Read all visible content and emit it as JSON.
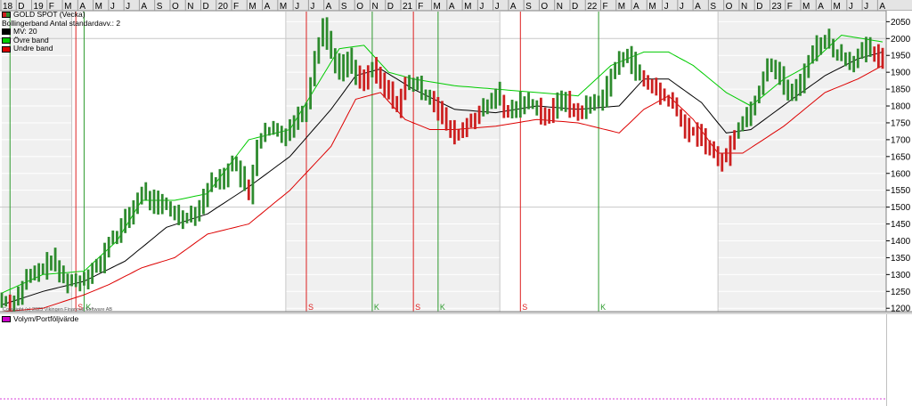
{
  "chart_data": {
    "type": "candlestick-bar",
    "title": "GOLD SPOT (Vecka)",
    "legend": [
      {
        "name": "GOLD SPOT (Vecka)",
        "color": "#2e8b2e",
        "color2": "#cc2020"
      },
      {
        "name": "Bollingerband  Antal standardavv.: 2",
        "color": null
      },
      {
        "name": "MV: 20",
        "color": "#000000"
      },
      {
        "name": "Övre band",
        "color": "#00cc00"
      },
      {
        "name": "Undre band",
        "color": "#dd0000"
      }
    ],
    "volume_legend": {
      "name": "Volym/Portföljvärde",
      "color": "#cc00cc"
    },
    "copyright": "Copyright (c) 2023 Vikingen Financial Software AB",
    "x_axis_months": [
      "18",
      "D",
      "19",
      "F",
      "M",
      "A",
      "M",
      "J",
      "J",
      "A",
      "S",
      "O",
      "N",
      "D",
      "20",
      "F",
      "M",
      "A",
      "M",
      "J",
      "J",
      "A",
      "S",
      "O",
      "N",
      "D",
      "21",
      "F",
      "M",
      "A",
      "M",
      "J",
      "J",
      "A",
      "S",
      "O",
      "N",
      "D",
      "22",
      "F",
      "M",
      "A",
      "M",
      "J",
      "J",
      "A",
      "S",
      "O",
      "N",
      "D",
      "23",
      "F",
      "M",
      "A",
      "M",
      "J",
      "J",
      "A"
    ],
    "y_ticks": [
      1200,
      1250,
      1300,
      1350,
      1400,
      1450,
      1500,
      1550,
      1600,
      1650,
      1700,
      1750,
      1800,
      1850,
      1900,
      1950,
      2000,
      2050
    ],
    "ylim": [
      1190,
      2080
    ],
    "signals": [
      {
        "label": "",
        "type": "buy"
      },
      {
        "label": "S",
        "type": "sell"
      },
      {
        "label": "K",
        "type": "buy"
      },
      {
        "label": "S",
        "type": "sell"
      },
      {
        "label": "K",
        "type": "buy"
      },
      {
        "label": "S",
        "type": "sell"
      },
      {
        "label": "K",
        "type": "buy"
      },
      {
        "label": "S",
        "type": "sell"
      },
      {
        "label": "K",
        "type": "buy"
      }
    ],
    "series": [
      {
        "name": "GOLD SPOT (Vecka)",
        "type": "ohlc",
        "keypoints": [
          [
            0,
            1225
          ],
          [
            2,
            1215
          ],
          [
            4,
            1240
          ],
          [
            6,
            1290
          ],
          [
            8,
            1300
          ],
          [
            10,
            1320
          ],
          [
            12,
            1345
          ],
          [
            14,
            1300
          ],
          [
            16,
            1280
          ],
          [
            18,
            1280
          ],
          [
            20,
            1290
          ],
          [
            22,
            1320
          ],
          [
            24,
            1330
          ],
          [
            26,
            1400
          ],
          [
            28,
            1420
          ],
          [
            30,
            1460
          ],
          [
            32,
            1500
          ],
          [
            34,
            1545
          ],
          [
            36,
            1520
          ],
          [
            38,
            1510
          ],
          [
            40,
            1500
          ],
          [
            42,
            1480
          ],
          [
            44,
            1470
          ],
          [
            46,
            1480
          ],
          [
            48,
            1500
          ],
          [
            50,
            1560
          ],
          [
            52,
            1580
          ],
          [
            54,
            1590
          ],
          [
            56,
            1640
          ],
          [
            58,
            1590
          ],
          [
            60,
            1530
          ],
          [
            62,
            1690
          ],
          [
            64,
            1720
          ],
          [
            66,
            1730
          ],
          [
            68,
            1710
          ],
          [
            70,
            1740
          ],
          [
            72,
            1770
          ],
          [
            74,
            1800
          ],
          [
            76,
            1950
          ],
          [
            78,
            2040
          ],
          [
            80,
            1960
          ],
          [
            82,
            1900
          ],
          [
            84,
            1940
          ],
          [
            86,
            1890
          ],
          [
            88,
            1880
          ],
          [
            90,
            1910
          ],
          [
            92,
            1870
          ],
          [
            94,
            1840
          ],
          [
            96,
            1800
          ],
          [
            98,
            1860
          ],
          [
            100,
            1870
          ],
          [
            102,
            1840
          ],
          [
            104,
            1830
          ],
          [
            106,
            1790
          ],
          [
            108,
            1740
          ],
          [
            110,
            1710
          ],
          [
            112,
            1730
          ],
          [
            114,
            1760
          ],
          [
            116,
            1780
          ],
          [
            118,
            1800
          ],
          [
            120,
            1840
          ],
          [
            122,
            1780
          ],
          [
            124,
            1790
          ],
          [
            126,
            1810
          ],
          [
            128,
            1810
          ],
          [
            130,
            1800
          ],
          [
            132,
            1760
          ],
          [
            134,
            1790
          ],
          [
            136,
            1830
          ],
          [
            138,
            1790
          ],
          [
            140,
            1780
          ],
          [
            142,
            1800
          ],
          [
            144,
            1810
          ],
          [
            146,
            1830
          ],
          [
            148,
            1890
          ],
          [
            150,
            1930
          ],
          [
            152,
            1960
          ],
          [
            154,
            1900
          ],
          [
            156,
            1870
          ],
          [
            158,
            1860
          ],
          [
            160,
            1830
          ],
          [
            162,
            1820
          ],
          [
            164,
            1780
          ],
          [
            166,
            1730
          ],
          [
            168,
            1720
          ],
          [
            170,
            1710
          ],
          [
            172,
            1670
          ],
          [
            174,
            1640
          ],
          [
            176,
            1650
          ],
          [
            178,
            1720
          ],
          [
            180,
            1760
          ],
          [
            182,
            1790
          ],
          [
            184,
            1850
          ],
          [
            186,
            1930
          ],
          [
            188,
            1910
          ],
          [
            190,
            1860
          ],
          [
            192,
            1830
          ],
          [
            194,
            1870
          ],
          [
            196,
            1940
          ],
          [
            198,
            1980
          ],
          [
            200,
            2000
          ],
          [
            202,
            1960
          ],
          [
            204,
            1950
          ],
          [
            206,
            1930
          ],
          [
            208,
            1950
          ],
          [
            210,
            1970
          ],
          [
            212,
            1950
          ],
          [
            214,
            1930
          ]
        ]
      },
      {
        "name": "MV: 20",
        "type": "line",
        "keypoints": [
          [
            0,
            1210
          ],
          [
            10,
            1250
          ],
          [
            20,
            1280
          ],
          [
            30,
            1340
          ],
          [
            40,
            1440
          ],
          [
            50,
            1480
          ],
          [
            60,
            1560
          ],
          [
            70,
            1650
          ],
          [
            80,
            1790
          ],
          [
            86,
            1890
          ],
          [
            92,
            1910
          ],
          [
            100,
            1850
          ],
          [
            110,
            1790
          ],
          [
            120,
            1780
          ],
          [
            130,
            1800
          ],
          [
            140,
            1790
          ],
          [
            150,
            1800
          ],
          [
            156,
            1880
          ],
          [
            162,
            1880
          ],
          [
            170,
            1810
          ],
          [
            176,
            1720
          ],
          [
            182,
            1730
          ],
          [
            192,
            1820
          ],
          [
            200,
            1890
          ],
          [
            208,
            1940
          ],
          [
            214,
            1960
          ]
        ]
      },
      {
        "name": "Övre band",
        "type": "line",
        "keypoints": [
          [
            0,
            1245
          ],
          [
            10,
            1300
          ],
          [
            20,
            1310
          ],
          [
            28,
            1400
          ],
          [
            34,
            1520
          ],
          [
            42,
            1520
          ],
          [
            50,
            1540
          ],
          [
            60,
            1700
          ],
          [
            70,
            1730
          ],
          [
            76,
            1850
          ],
          [
            82,
            1970
          ],
          [
            88,
            1980
          ],
          [
            94,
            1900
          ],
          [
            100,
            1880
          ],
          [
            110,
            1860
          ],
          [
            120,
            1850
          ],
          [
            130,
            1840
          ],
          [
            140,
            1830
          ],
          [
            148,
            1920
          ],
          [
            156,
            1960
          ],
          [
            162,
            1960
          ],
          [
            168,
            1920
          ],
          [
            176,
            1840
          ],
          [
            182,
            1800
          ],
          [
            190,
            1880
          ],
          [
            196,
            1920
          ],
          [
            204,
            2010
          ],
          [
            214,
            1990
          ]
        ]
      },
      {
        "name": "Undre band",
        "type": "line",
        "keypoints": [
          [
            0,
            1190
          ],
          [
            10,
            1200
          ],
          [
            20,
            1240
          ],
          [
            26,
            1270
          ],
          [
            34,
            1320
          ],
          [
            42,
            1350
          ],
          [
            50,
            1420
          ],
          [
            60,
            1450
          ],
          [
            70,
            1550
          ],
          [
            80,
            1680
          ],
          [
            86,
            1820
          ],
          [
            92,
            1840
          ],
          [
            98,
            1760
          ],
          [
            104,
            1730
          ],
          [
            110,
            1730
          ],
          [
            120,
            1740
          ],
          [
            130,
            1760
          ],
          [
            140,
            1750
          ],
          [
            150,
            1720
          ],
          [
            156,
            1790
          ],
          [
            162,
            1830
          ],
          [
            168,
            1760
          ],
          [
            174,
            1660
          ],
          [
            180,
            1660
          ],
          [
            190,
            1740
          ],
          [
            200,
            1840
          ],
          [
            208,
            1880
          ],
          [
            214,
            1920
          ]
        ]
      }
    ]
  }
}
